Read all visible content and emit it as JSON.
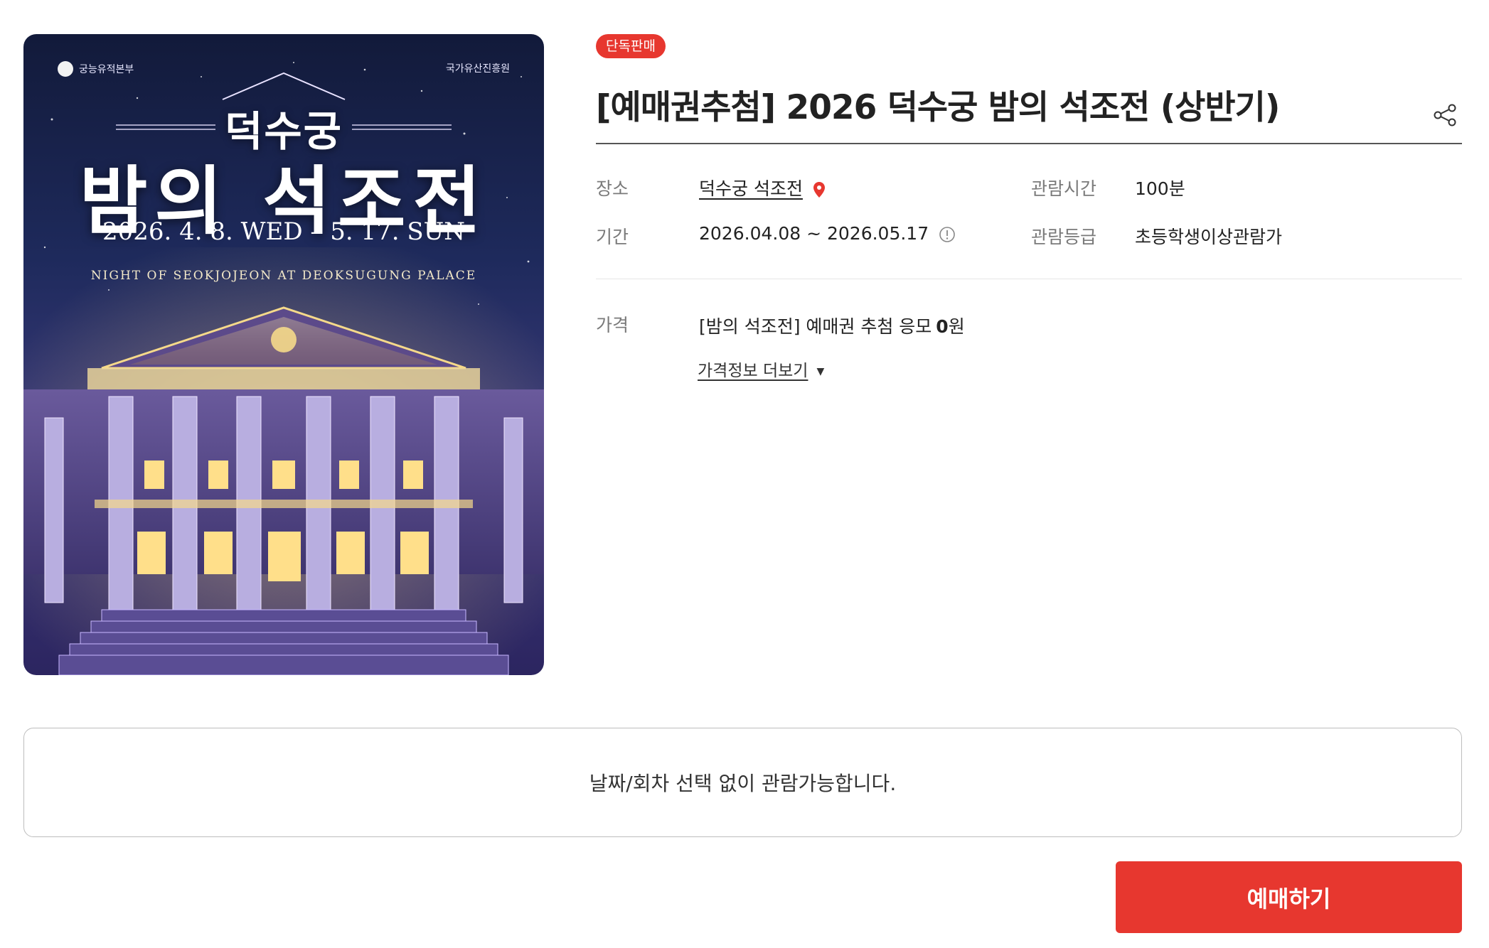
{
  "product": {
    "badge": "단독판매",
    "title": "[예매권추첨] 2026 덕수궁 밤의 석조전 (상반기)",
    "share_icon": "share-icon"
  },
  "poster": {
    "title_line1": "덕수궁",
    "title_line2": "밤의 석조전",
    "date_text": "2026. 4. 8. WED – 5. 17. SUN",
    "subtitle": "NIGHT OF SEOKJOJEON AT DEOKSUGUNG PALACE",
    "org_left": "궁능유적본부",
    "org_right": "국가유산진흥원"
  },
  "info": {
    "venue_label": "장소",
    "venue_value": "덕수궁 석조전",
    "runtime_label": "관람시간",
    "runtime_value": "100분",
    "period_label": "기간",
    "period_value": "2026.04.08 ~ 2026.05.17",
    "rating_label": "관람등급",
    "rating_value": "초등학생이상관람가",
    "price_label": "가격",
    "price_item": "[밤의 석조전] 예매권 추첨 응모",
    "price_amount_num": "0",
    "price_amount_unit": "원",
    "price_more": "가격정보 더보기"
  },
  "notice": {
    "text": "날짜/회차 선택 없이 관람가능합니다."
  },
  "actions": {
    "book_label": "예매하기"
  },
  "colors": {
    "accent": "#e7372f",
    "label_gray": "#7a7a7a",
    "text_dark": "#222222"
  }
}
